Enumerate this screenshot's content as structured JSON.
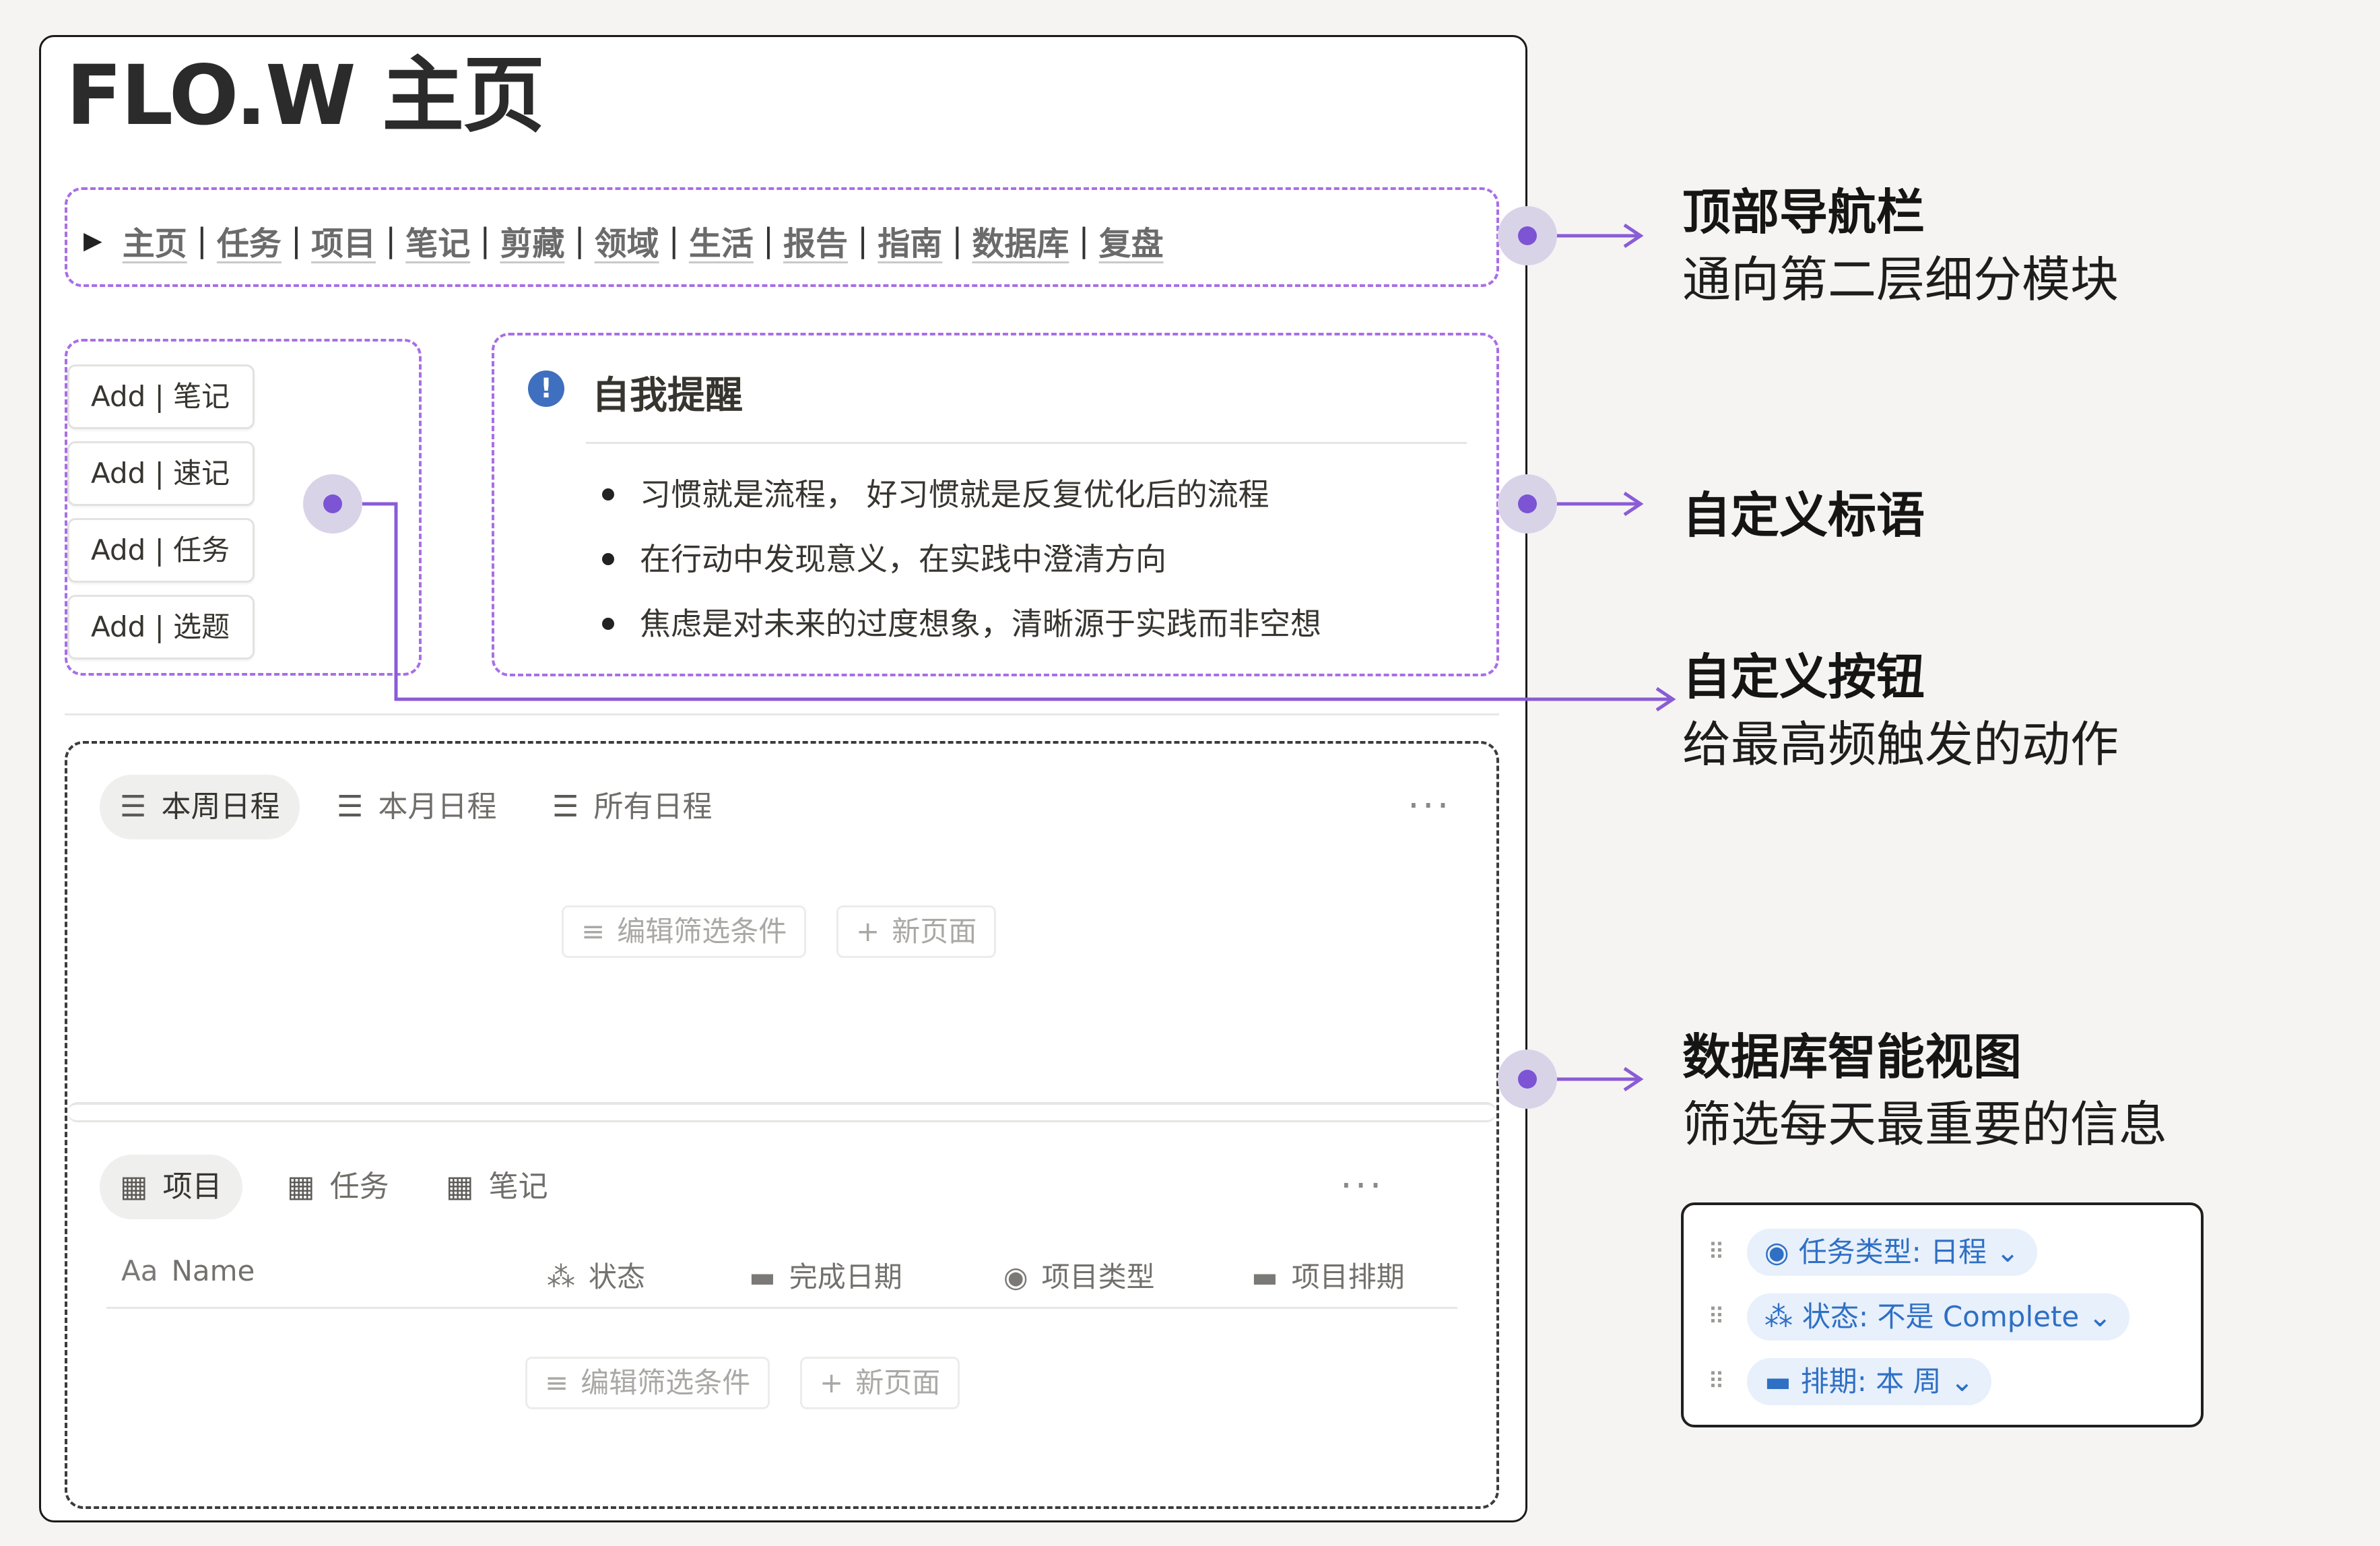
{
  "page": {
    "title": "FLO.W 主页"
  },
  "nav": {
    "toggle_icon": "triangle-right-icon",
    "separator": "|",
    "items": [
      "主页",
      "任务",
      "项目",
      "笔记",
      "剪藏",
      "领域",
      "生活",
      "报告",
      "指南",
      "数据库",
      "复盘"
    ]
  },
  "buttons": [
    "Add | 笔记",
    "Add | 速记",
    "Add | 任务",
    "Add | 选题"
  ],
  "callout": {
    "icon": "!",
    "title": "自我提醒",
    "bullets": [
      "习惯就是流程， 好习惯就是反复优化后的流程",
      "在行动中发现意义，在实践中澄清方向",
      "焦虑是对未来的过度想象，清晰源于实践而非空想"
    ]
  },
  "schedule_view": {
    "tabs": [
      "本周日程",
      "本月日程",
      "所有日程"
    ],
    "more": "···",
    "filter_button": "编辑筛选条件",
    "new_page_button": "新页面"
  },
  "project_view": {
    "tabs": [
      "项目",
      "任务",
      "笔记"
    ],
    "more": "···",
    "columns": [
      "Name",
      "状态",
      "完成日期",
      "项目类型",
      "项目排期"
    ],
    "name_column_icon": "Aa",
    "filter_button": "编辑筛选条件",
    "new_page_button": "新页面"
  },
  "annotations": {
    "nav": {
      "title": "顶部导航栏",
      "subtitle": "通向第二层细分模块"
    },
    "slogan": {
      "title": "自定义标语"
    },
    "buttons": {
      "title": "自定义按钮",
      "subtitle": "给最高频触发的动作"
    },
    "database": {
      "title": "数据库智能视图",
      "subtitle": "筛选每天最重要的信息"
    }
  },
  "filters": [
    {
      "label": "任务类型: 日程",
      "icon": "select-circle-icon"
    },
    {
      "label": "状态: 不是 Complete",
      "icon": "status-spinner-icon"
    },
    {
      "label": "排期: 本 周",
      "icon": "calendar-icon"
    }
  ],
  "colors": {
    "accent": "#7c54d4",
    "dashed_border": "#a86ee6",
    "chip_bg": "#e7f0fb",
    "chip_text": "#2f6fc4",
    "callout_icon": "#3f6fbf"
  }
}
